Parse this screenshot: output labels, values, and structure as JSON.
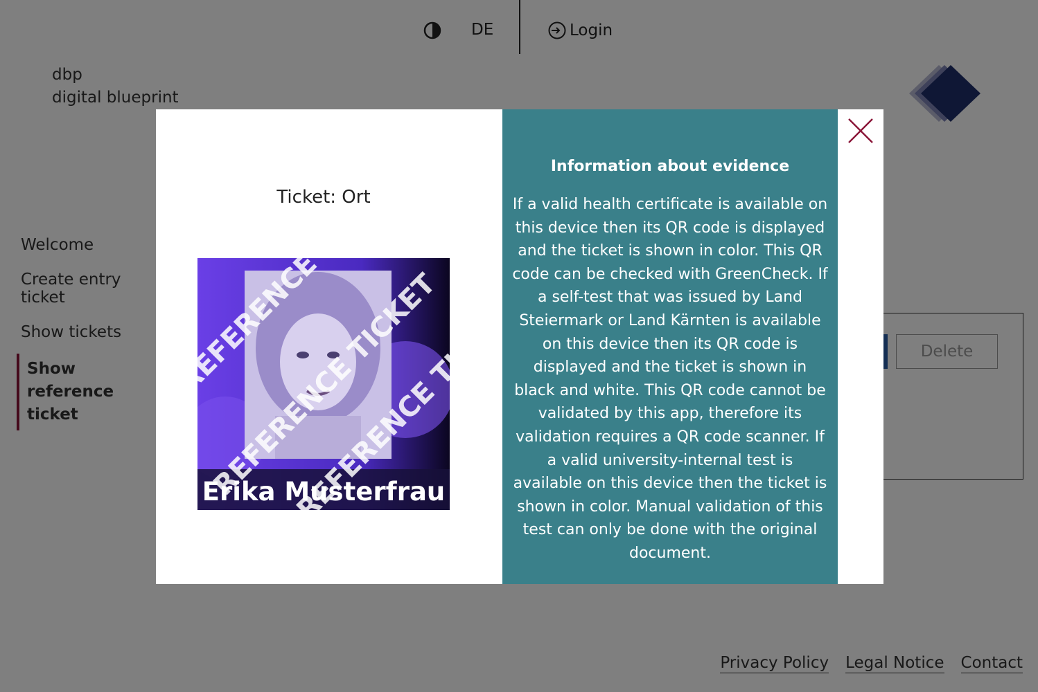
{
  "header": {
    "language": "DE",
    "login_label": "Login"
  },
  "brand": {
    "line1": "dbp",
    "line2": "digital blueprint"
  },
  "sidebar": {
    "items": [
      {
        "label": "Welcome"
      },
      {
        "label": "Create entry ticket"
      },
      {
        "label": "Show tickets"
      },
      {
        "label": "Show reference ticket",
        "active": true
      }
    ]
  },
  "main": {
    "delete_label": "Delete"
  },
  "footer": {
    "links": [
      "Privacy Policy",
      "Legal Notice",
      "Contact"
    ]
  },
  "modal": {
    "ticket_title": "Ticket: Ort",
    "ticket_image": {
      "watermark": "REFERENCE TICKET",
      "name": "Erika Musterfrau"
    },
    "info_heading": "Information about evidence",
    "info_text": "If a valid health certificate is available on this device then its QR code is displayed and the ticket is shown in color. This QR code can be checked with GreenCheck. If a self-test that was issued by Land Steiermark or Land Kärnten is available on this device then its QR code is displayed and the ticket is shown in black and white. This QR code cannot be validated by this app, therefore its validation requires a QR code scanner. If a valid university-internal test is available on this device then the ticket is shown in color. Manual validation of this test can only be done with the original document."
  },
  "icons": {
    "contrast": "contrast-icon",
    "login": "login-icon",
    "close": "close-icon",
    "logo": "dbp-logo"
  },
  "colors": {
    "accent": "#8a1538",
    "info_panel": "#3a808a",
    "overlay": "rgba(0,0,0,0.5)",
    "ticket_purple": "#5b3bd6"
  }
}
